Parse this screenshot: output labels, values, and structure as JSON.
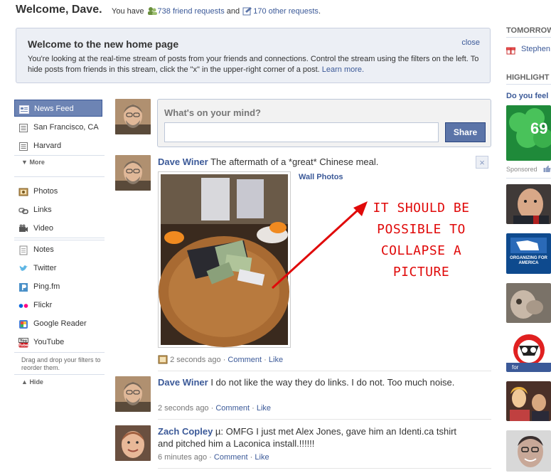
{
  "header": {
    "welcome": "Welcome, Dave.",
    "you_have": "You have",
    "friend_requests": "738 friend requests",
    "and": "and",
    "other_requests": "170 other requests",
    "period": "."
  },
  "welcome_box": {
    "title": "Welcome to the new home page",
    "close": "close",
    "body": "You're looking at the real-time stream of posts from your friends and connections. Control the stream using the filters on the left. To hide posts from friends in this stream, click the \"x\" in the upper-right corner of a post.",
    "learn_more": "Learn more."
  },
  "sidebar": {
    "group1": [
      {
        "label": "News Feed",
        "icon": "news-feed-icon"
      },
      {
        "label": "San Francisco, CA",
        "icon": "network-icon"
      },
      {
        "label": "Harvard",
        "icon": "network-icon"
      }
    ],
    "more": "More",
    "group2": [
      {
        "label": "Photos",
        "icon": "photos-icon"
      },
      {
        "label": "Links",
        "icon": "links-icon"
      },
      {
        "label": "Video",
        "icon": "video-icon"
      }
    ],
    "group3": [
      {
        "label": "Notes",
        "icon": "notes-icon"
      },
      {
        "label": "Twitter",
        "icon": "twitter-icon"
      },
      {
        "label": "Ping.fm",
        "icon": "pingfm-icon"
      },
      {
        "label": "Flickr",
        "icon": "flickr-icon"
      },
      {
        "label": "Google Reader",
        "icon": "google-reader-icon"
      },
      {
        "label": "YouTube",
        "icon": "youtube-icon"
      }
    ],
    "drag_hint": "Drag and drop your filters to reorder them.",
    "hide": "Hide"
  },
  "composer": {
    "prompt": "What's on your mind?",
    "value": "",
    "share": "Share"
  },
  "posts": [
    {
      "author": "Dave Winer",
      "text": "The aftermath of a *great* Chinese meal.",
      "album": "Wall Photos",
      "time": "2 seconds ago",
      "comment": "Comment",
      "like": "Like",
      "remove": "×"
    },
    {
      "author": "Dave Winer",
      "text": "I do not like the way they do links. I do not. Too much noise.",
      "time": "2 seconds ago",
      "comment": "Comment",
      "like": "Like"
    },
    {
      "author": "Zach Copley",
      "text": "µ: OMFG I just met Alex Jones, gave him an Identi.ca tshirt and pitched him a Laconica install.!!!!!!",
      "time": "6 minutes ago",
      "comment": "Comment",
      "like": "Like"
    }
  ],
  "annotation": {
    "line1": "IT SHOULD BE",
    "line2": "POSSIBLE TO",
    "line3": "COLLAPSE A",
    "line4": "PICTURE"
  },
  "right_column": {
    "tomorrow_heading": "TOMORROW",
    "birthday_name": "Stephen",
    "highlights_heading": "HIGHLIGHT",
    "do_you_feel": "Do you feel",
    "ad_number": "69",
    "sponsored": "Sponsored",
    "organizing_text": "ORGANIZING FOR AMERICA",
    "for_label": "for"
  },
  "separator": "·",
  "colors": {
    "brand": "#3b5998",
    "annotation": "#e00a0a",
    "active_filter": "#6d84b4"
  }
}
